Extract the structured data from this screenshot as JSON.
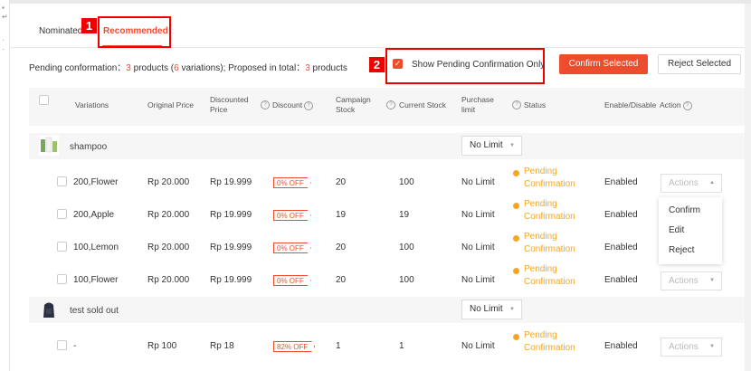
{
  "tabs": [
    {
      "label": "Nominated"
    },
    {
      "label": "Recommended"
    }
  ],
  "annotations": {
    "badge1": "1",
    "badge2": "2"
  },
  "summary": {
    "prefix": "Pending conformation：",
    "products_count": "3",
    "products_word": " products (",
    "variations_count": "6",
    "variations_word": " variations); Proposed in total：",
    "total_count": "3",
    "total_word": " products"
  },
  "filter": {
    "label": "Show Pending Confirmation Only",
    "checked": true
  },
  "buttons": {
    "confirm": "Confirm Selected",
    "reject": "Reject Selected"
  },
  "columns": {
    "variations": "Variations",
    "original_price": "Original Price",
    "discounted_price_1": "Discounted",
    "discounted_price_2": "Price",
    "discount": "Discount",
    "campaign_stock_1": "Campaign",
    "campaign_stock_2": "Stock",
    "current_stock": "Current Stock",
    "purchase_limit_1": "Purchase",
    "purchase_limit_2": "limit",
    "status": "Status",
    "enable_disable": "Enable/Disable",
    "action": "Action"
  },
  "products": [
    {
      "name": "shampoo",
      "limit": "No Limit",
      "variations": [
        {
          "name": "200,Flower",
          "original": "Rp 20.000",
          "discounted": "Rp 19.999",
          "discount": "0% OFF",
          "campaign_stock": "20",
          "current_stock": "100",
          "purchase_limit": "No Limit",
          "status_1": "Pending",
          "status_2": "Confirmation",
          "enabled": "Enabled",
          "action": "Actions"
        },
        {
          "name": "200,Apple",
          "original": "Rp 20.000",
          "discounted": "Rp 19.999",
          "discount": "0% OFF",
          "campaign_stock": "19",
          "current_stock": "19",
          "purchase_limit": "No Limit",
          "status_1": "Pending",
          "status_2": "Confirmation",
          "enabled": "Enabled"
        },
        {
          "name": "100,Lemon",
          "original": "Rp 20.000",
          "discounted": "Rp 19.999",
          "discount": "0% OFF",
          "campaign_stock": "20",
          "current_stock": "100",
          "purchase_limit": "No Limit",
          "status_1": "Pending",
          "status_2": "Confirmation",
          "enabled": "Enabled"
        },
        {
          "name": "100,Flower",
          "original": "Rp 20.000",
          "discounted": "Rp 19.999",
          "discount": "0% OFF",
          "campaign_stock": "20",
          "current_stock": "100",
          "purchase_limit": "No Limit",
          "status_1": "Pending",
          "status_2": "Confirmation",
          "enabled": "Enabled",
          "action": "Actions"
        }
      ]
    },
    {
      "name": "test sold out",
      "limit": "No Limit",
      "variations": [
        {
          "name": "-",
          "original": "Rp 100",
          "discounted": "Rp 18",
          "discount": "82% OFF",
          "campaign_stock": "1",
          "current_stock": "1",
          "purchase_limit": "No Limit",
          "status_1": "Pending",
          "status_2": "Confirmation",
          "enabled": "Enabled",
          "action": "Actions"
        }
      ]
    }
  ],
  "actions_menu": [
    "Confirm",
    "Edit",
    "Reject"
  ],
  "colors": {
    "accent": "#ee4d2d",
    "pending": "#f5a623",
    "annotation": "#ee0000"
  }
}
